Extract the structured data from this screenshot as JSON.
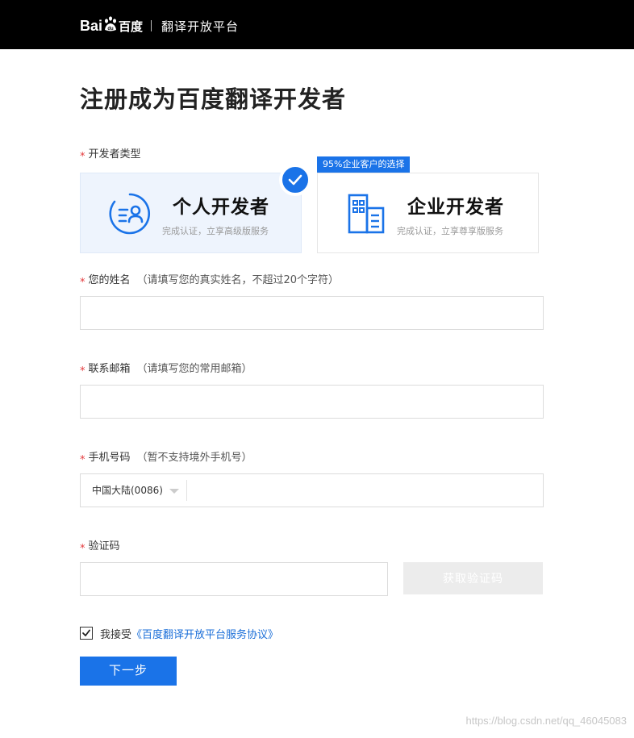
{
  "header": {
    "logo_bai": "Bai",
    "logo_du": "百度",
    "logo_paw_text": "du",
    "platform_name": "翻译开放平台"
  },
  "page": {
    "title": "注册成为百度翻译开发者"
  },
  "developer_type": {
    "required_mark": "*",
    "label": "开发者类型",
    "badge": "95%企业客户的选择",
    "options": [
      {
        "name": "个人开发者",
        "desc": "完成认证，立享高级版服务",
        "selected": true,
        "icon": "personal-id-icon"
      },
      {
        "name": "企业开发者",
        "desc": "完成认证，立享尊享版服务",
        "selected": false,
        "icon": "building-icon"
      }
    ]
  },
  "name_field": {
    "required_mark": "*",
    "label": "您的姓名",
    "hint": "（请填写您的真实姓名，不超过20个字符）",
    "value": ""
  },
  "email_field": {
    "required_mark": "*",
    "label": "联系邮箱",
    "hint": "（请填写您的常用邮箱）",
    "value": ""
  },
  "phone_field": {
    "required_mark": "*",
    "label": "手机号码",
    "hint": "（暂不支持境外手机号）",
    "country": "中国大陆(0086)",
    "value": ""
  },
  "code_field": {
    "required_mark": "*",
    "label": "验证码",
    "value": "",
    "button_label": "获取验证码"
  },
  "agreement": {
    "checked": true,
    "prefix": "我接受",
    "link_text": "《百度翻译开放平台服务协议》"
  },
  "next_button_label": "下一步",
  "watermark": "https://blog.csdn.net/qq_46045083",
  "colors": {
    "accent": "#1a73e8",
    "required": "#e4393c",
    "topbar": "#000000"
  }
}
